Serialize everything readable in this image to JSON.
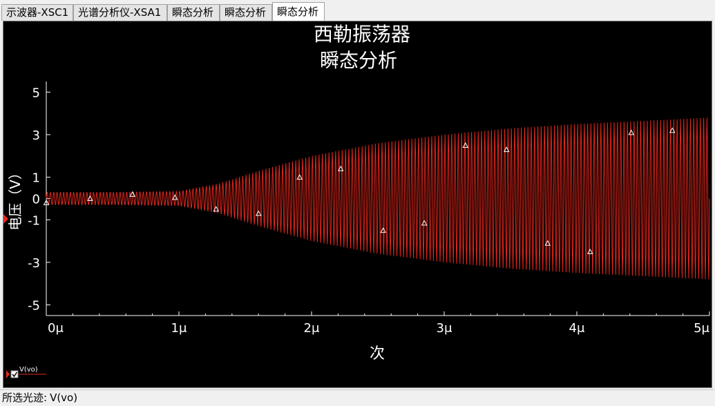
{
  "tabs": [
    {
      "label": "示波器-XSC1",
      "active": false
    },
    {
      "label": "光谱分析仪-XSA1",
      "active": false
    },
    {
      "label": "瞬态分析",
      "active": false
    },
    {
      "label": "瞬态分析",
      "active": false
    },
    {
      "label": "瞬态分析",
      "active": true
    }
  ],
  "colors": {
    "trace": "#e8271c",
    "background": "#000000",
    "axis": "#ffffff"
  },
  "status": {
    "label": "所选光迹:",
    "value": "V(vo)"
  },
  "chart_data": {
    "type": "line",
    "title": "西勒振荡器",
    "subtitle": "瞬态分析",
    "xlabel": "次",
    "ylabel": "电压（V）",
    "xlim": [
      0,
      5
    ],
    "ylim": [
      -5.5,
      5.5
    ],
    "x_ticks": [
      "0μ",
      "1μ",
      "2μ",
      "3μ",
      "4μ",
      "5μ"
    ],
    "y_ticks": [
      "5",
      "3",
      "1",
      "0",
      "-1",
      "-3",
      "-5"
    ],
    "grid": false,
    "legend": "bottom-left",
    "series": [
      {
        "name": "V(vo)",
        "color": "#e8271c",
        "envelope_x": [
          0,
          0.5,
          1.0,
          1.3,
          1.6,
          2.0,
          2.5,
          3.0,
          3.5,
          4.0,
          4.5,
          5.0
        ],
        "envelope_amp": [
          0.3,
          0.3,
          0.35,
          0.7,
          1.3,
          2.0,
          2.6,
          3.0,
          3.3,
          3.5,
          3.65,
          3.8
        ],
        "oscillation_cycles": 200,
        "markers": [
          {
            "x": 0.0,
            "y": -0.2
          },
          {
            "x": 0.33,
            "y": 0.0
          },
          {
            "x": 0.65,
            "y": 0.2
          },
          {
            "x": 0.97,
            "y": 0.05
          },
          {
            "x": 1.28,
            "y": -0.5
          },
          {
            "x": 1.6,
            "y": -0.7
          },
          {
            "x": 1.91,
            "y": 1.0
          },
          {
            "x": 2.22,
            "y": 1.4
          },
          {
            "x": 2.54,
            "y": -1.5
          },
          {
            "x": 2.85,
            "y": -1.15
          },
          {
            "x": 3.16,
            "y": 2.5
          },
          {
            "x": 3.47,
            "y": 2.3
          },
          {
            "x": 3.78,
            "y": -2.1
          },
          {
            "x": 4.1,
            "y": -2.5
          },
          {
            "x": 4.41,
            "y": 3.1
          },
          {
            "x": 4.72,
            "y": 3.2
          }
        ]
      }
    ]
  }
}
